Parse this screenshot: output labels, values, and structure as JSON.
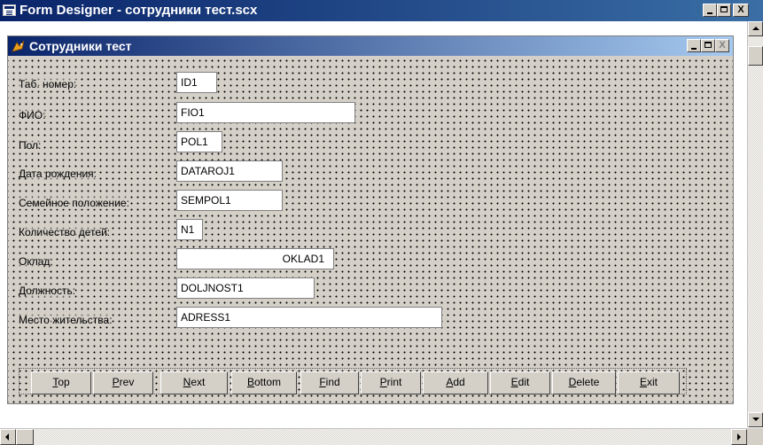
{
  "designer": {
    "title": "Form Designer - сотрудники тест.scx",
    "controls": {
      "minimize": "_",
      "maximize": "",
      "close": "X"
    }
  },
  "form": {
    "title": "Сотрудники тест",
    "fields": [
      {
        "label": "Таб. номер:",
        "value": "ID1"
      },
      {
        "label": "ФИО:",
        "value": "FIO1"
      },
      {
        "label": "Пол:",
        "value": "POL1"
      },
      {
        "label": "Дата рождения:",
        "value": "DATAROJ1"
      },
      {
        "label": "Семейное положение:",
        "value": "SEMPOL1"
      },
      {
        "label": "Количество детей:",
        "value": "N1"
      },
      {
        "label": "Оклад:",
        "value": "OKLAD1"
      },
      {
        "label": "Должность:",
        "value": "DOLJNOST1"
      },
      {
        "label": "Место жительства:",
        "value": "ADRESS1"
      }
    ],
    "buttons": [
      "Top",
      "Prev",
      "Next",
      "Bottom",
      "Find",
      "Print",
      "Add",
      "Edit",
      "Delete",
      "Exit"
    ]
  },
  "colors": {
    "titlebar": "#0a246a",
    "face": "#d4d0c8"
  }
}
